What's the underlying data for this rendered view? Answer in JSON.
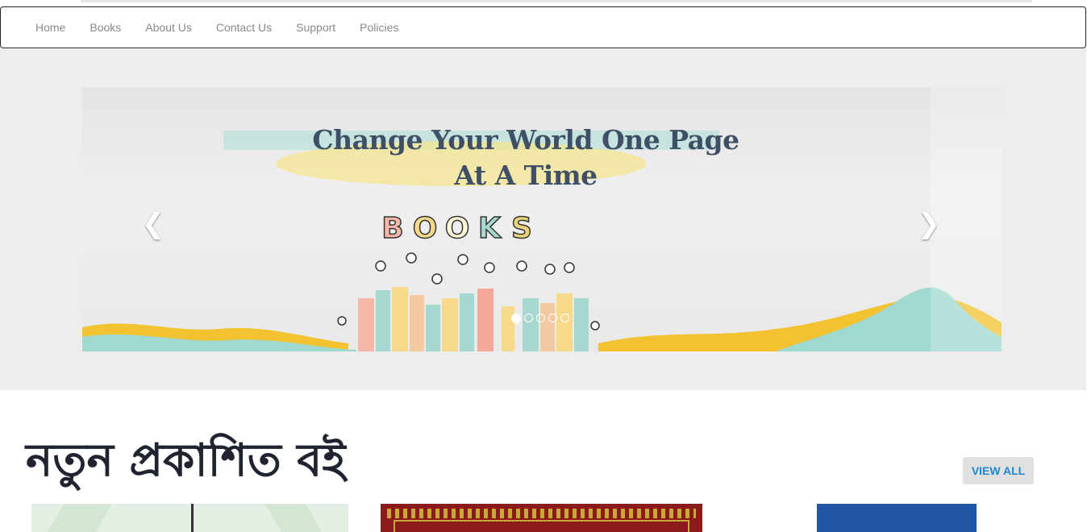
{
  "nav": {
    "items": [
      {
        "label": "Home"
      },
      {
        "label": "Books"
      },
      {
        "label": "About Us"
      },
      {
        "label": "Contact Us"
      },
      {
        "label": "Support"
      },
      {
        "label": "Policies"
      }
    ]
  },
  "carousel": {
    "headline_line1": "Change Your World One Page",
    "headline_line2": "At A Time",
    "letters": [
      "B",
      "O",
      "O",
      "K",
      "S"
    ],
    "prev_icon": "chevron-left-icon",
    "next_icon": "chevron-right-icon",
    "slide_count": 5,
    "active_slide": 1
  },
  "section": {
    "title": "নতুন প্রকাশিত বই",
    "view_all_label": "VIEW ALL"
  },
  "colors": {
    "headline": "#3e4f66",
    "view_all_text": "#1a8ad0",
    "hero_band": "#ededed"
  }
}
